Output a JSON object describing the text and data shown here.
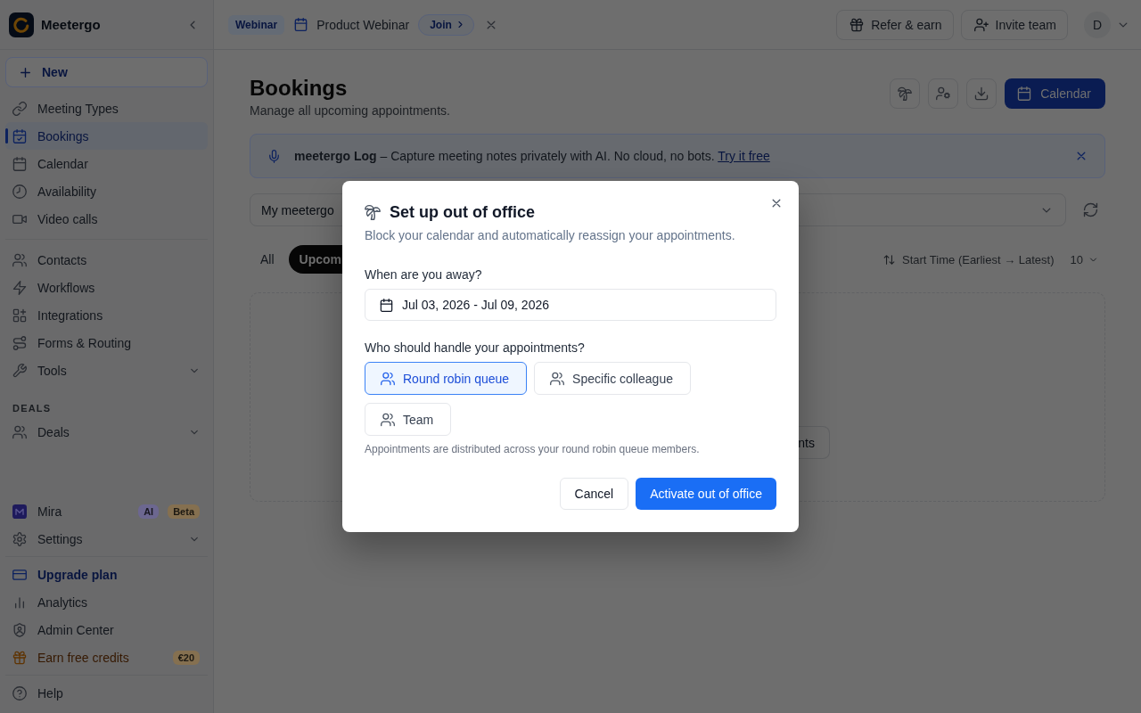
{
  "sidebar": {
    "brand": "Meetergo",
    "new_button": "New",
    "nav_groups": [
      [
        {
          "label": "Meeting Types",
          "selected": false
        },
        {
          "label": "Bookings",
          "selected": true
        },
        {
          "label": "Calendar",
          "selected": false
        },
        {
          "label": "Availability",
          "selected": false
        },
        {
          "label": "Video calls",
          "selected": false
        }
      ],
      [
        {
          "label": "Contacts",
          "selected": false
        },
        {
          "label": "Workflows",
          "selected": false
        },
        {
          "label": "Integrations",
          "selected": false
        },
        {
          "label": "Forms & Routing",
          "selected": false
        },
        {
          "label": "Tools",
          "selected": false,
          "expanded": false
        }
      ]
    ],
    "deals": {
      "heading": "DEALS",
      "items": [
        {
          "label": "Deals",
          "selected": false,
          "expanded": false
        }
      ]
    },
    "bottom_groups": [
      [
        {
          "label": "Mira",
          "selected": false,
          "badges": [
            {
              "text": "AI",
              "color": "#6c6790"
            },
            {
              "text": "Beta",
              "color": "#857050"
            }
          ]
        },
        {
          "label": "Settings",
          "selected": false,
          "expanded": false
        }
      ],
      [
        {
          "label": "Upgrade plan",
          "selected": false,
          "kind": "upgrade"
        },
        {
          "label": "Analytics",
          "selected": false,
          "kind": "link"
        },
        {
          "label": "Admin Center",
          "selected": false,
          "kind": "link"
        },
        {
          "label": "Earn free credits",
          "selected": false,
          "kind": "reward",
          "badges": [
            {
              "text": "€20",
              "color": "#857050"
            }
          ]
        }
      ],
      [
        {
          "label": "Help",
          "selected": false
        }
      ]
    ]
  },
  "topbar": {
    "announcement": {
      "tag": "Webinar",
      "title": "Product Webinar",
      "action": "Join"
    },
    "actions": [
      "Refer & earn",
      "Invite team"
    ],
    "avatar": "D"
  },
  "page": {
    "title": "Bookings",
    "subtitle": "Manage all upcoming appointments.",
    "primary_action": "Calendar",
    "banner": {
      "text": "**meetergo Log** – Capture meeting notes privately with AI. No cloud, no bots.",
      "link": "Try it free"
    },
    "filters": {
      "scope": "My meetergo"
    },
    "tabs": [
      {
        "label": "All",
        "selected": false
      },
      {
        "label": "Upcom",
        "selected": true
      }
    ],
    "sort": "Start Time (Earliest → Latest)",
    "page_size": "10",
    "empty_state": {
      "action": "nts"
    }
  },
  "dialog": {
    "title": "Set up out of office",
    "subtitle": "Block your calendar and automatically reassign your appointments.",
    "period_label": "When are you away?",
    "period": "Jul 03, 2026 - Jul 09, 2026",
    "handler_label": "Who should handle your appointments?",
    "handlers": [
      {
        "label": "Round robin queue",
        "selected": true
      },
      {
        "label": "Specific colleague",
        "selected": false
      },
      {
        "label": "Team",
        "selected": false
      }
    ],
    "hint": "Appointments are distributed across your round robin queue members.",
    "cancel": "Cancel",
    "confirm": "Activate out of office"
  }
}
